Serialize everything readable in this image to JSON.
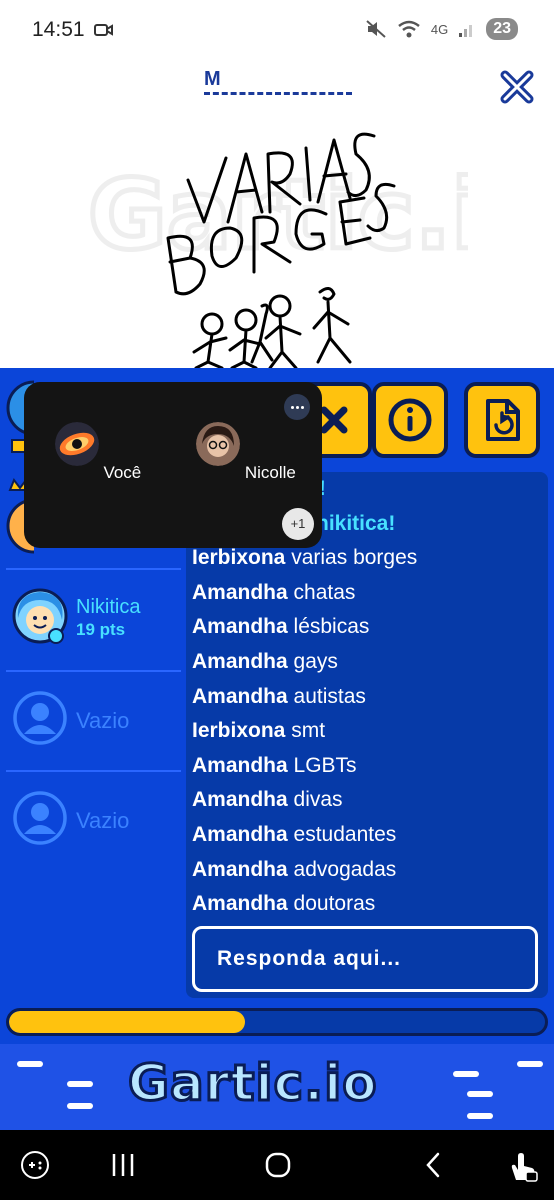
{
  "status_bar": {
    "time": "14:51",
    "network": "4G",
    "battery": "23"
  },
  "game": {
    "hint": "M",
    "drawing_text": [
      "VARIAS",
      "BORGES"
    ]
  },
  "tools": [
    {
      "icon": "close-x-icon"
    },
    {
      "icon": "info-icon"
    },
    {
      "icon": "report-flag-icon"
    }
  ],
  "call": {
    "participants": [
      {
        "name": "Você",
        "icon": "galaxy-avatar-icon"
      },
      {
        "name": "Nicolle",
        "icon": "photo-avatar-icon"
      }
    ],
    "more_count": "+1"
  },
  "players": [
    {
      "name": "Nikitica",
      "points": "19 pts"
    },
    {
      "name": "Vazio"
    },
    {
      "name": "Vazio"
    }
  ],
  "chat": {
    "messages": [
      {
        "system": true,
        "text": "o!"
      },
      {
        "system": true,
        "text": "nikitica!"
      },
      {
        "user": "Ierbixona",
        "text": "varias borges"
      },
      {
        "user": "Amandha",
        "text": "chatas"
      },
      {
        "user": "Amandha",
        "text": "lésbicas"
      },
      {
        "user": "Amandha",
        "text": "gays"
      },
      {
        "user": "Amandha",
        "text": "autistas"
      },
      {
        "user": "Ierbixona",
        "text": "smt"
      },
      {
        "user": "Amandha",
        "text": "LGBTs"
      },
      {
        "user": "Amandha",
        "text": "divas"
      },
      {
        "user": "Amandha",
        "text": "estudantes"
      },
      {
        "user": "Amandha",
        "text": "advogadas"
      },
      {
        "user": "Amandha",
        "text": "doutoras"
      }
    ],
    "answer_placeholder": "Responda aqui..."
  },
  "timer": {
    "progress": 0.44
  },
  "banner": {
    "logo_text": "Gartic.io"
  },
  "colors": {
    "panel_blue": "#0b45d9",
    "accent_yellow": "#ffc20e",
    "cyan": "#48e0ff",
    "dark_navy": "#0a1d55"
  }
}
